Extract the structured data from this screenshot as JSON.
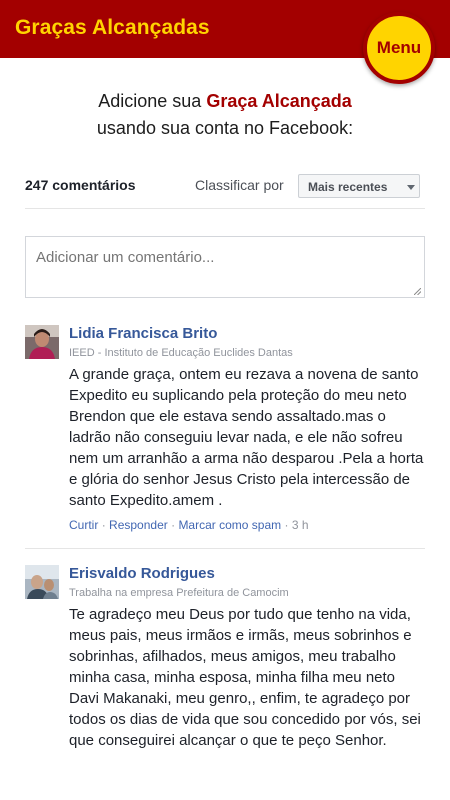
{
  "header": {
    "title": "Graças Alcançadas",
    "menu_label": "Menu",
    "bg_color": "#a30000",
    "accent_color": "#ffd400"
  },
  "intro": {
    "line1_prefix": "Adicione sua ",
    "line1_highlight": "Graça Alcançada",
    "line2": "usando sua conta no Facebook:"
  },
  "comments_plugin": {
    "count_label": "247 comentários",
    "sort_label": "Classificar por",
    "sort_selected": "Mais recentes",
    "input_placeholder": "Adicionar um comentário..."
  },
  "comments": [
    {
      "author": "Lidia Francisca Brito",
      "affiliation": "IEED - Instituto de Educação Euclides Dantas",
      "text": "A grande graça, ontem eu rezava a novena de santo Expedito eu suplicando pela proteção do meu neto Brendon que ele estava sendo assaltado.mas o ladrão não conseguiu levar nada, e ele não sofreu nem um arranhão a arma não desparou .Pela a horta e glória do senhor Jesus Cristo pela intercessão de santo Expedito.amem .",
      "actions": {
        "like": "Curtir",
        "reply": "Responder",
        "spam": "Marcar como spam",
        "sep": "·",
        "time": "3 h"
      }
    },
    {
      "author": "Erisvaldo Rodrigues",
      "affiliation": "Trabalha na empresa Prefeitura de Camocim",
      "text": "Te agradeço meu Deus por tudo que tenho na vida, meus pais, meus irmãos e irmãs, meus sobrinhos e sobrinhas, afilhados, meus amigos, meu trabalho minha casa, minha esposa, minha filha meu neto Davi Makanaki, meu genro,, enfim, te agradeço por todos os dias de vida que sou concedido por vós, sei que conseguirei alcançar o que te peço Senhor."
    }
  ]
}
